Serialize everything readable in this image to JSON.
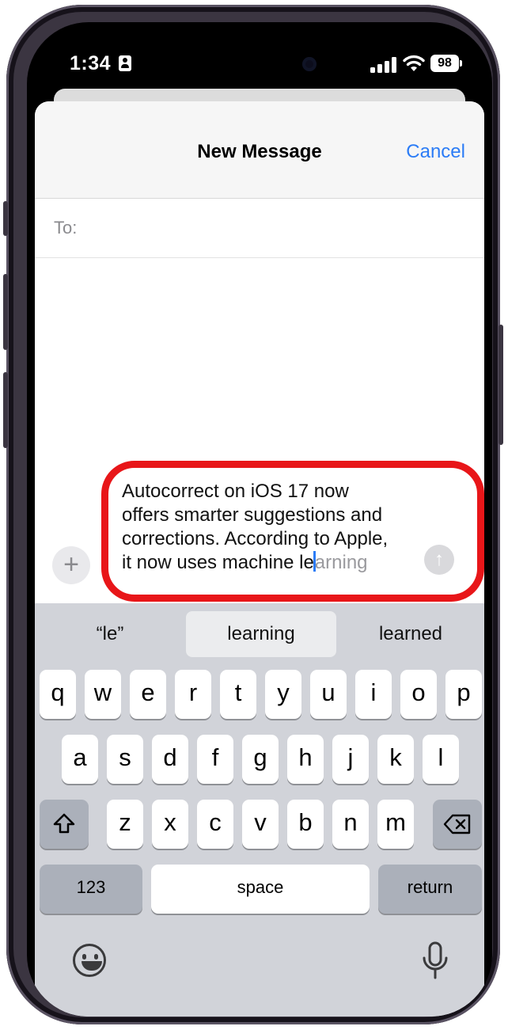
{
  "status_bar": {
    "time": "1:34",
    "battery": "98"
  },
  "nav": {
    "title": "New Message",
    "cancel": "Cancel"
  },
  "to_field": {
    "label": "To:"
  },
  "message": {
    "lines": [
      "Autocorrect on iOS 17 now",
      "offers smarter suggestions and",
      "corrections. According to Apple,"
    ],
    "last_line_typed": "it now uses machine le",
    "last_line_predicted": "arning"
  },
  "suggestions": [
    "“le”",
    "learning",
    "learned"
  ],
  "keyboard": {
    "row1": [
      "q",
      "w",
      "e",
      "r",
      "t",
      "y",
      "u",
      "i",
      "o",
      "p"
    ],
    "row2": [
      "a",
      "s",
      "d",
      "f",
      "g",
      "h",
      "j",
      "k",
      "l"
    ],
    "row3": [
      "z",
      "x",
      "c",
      "v",
      "b",
      "n",
      "m"
    ],
    "numbers_key": "123",
    "space_key": "space",
    "return_key": "return"
  },
  "colors": {
    "accent": "#2b7cf6",
    "highlight": "#e81619",
    "keyboard_bg": "#d1d3d9"
  },
  "icons": {
    "plus": "plus-icon",
    "send": "send-arrow-icon",
    "shift": "shift-icon",
    "delete": "delete-icon",
    "emoji": "emoji-icon",
    "mic": "microphone-icon"
  }
}
